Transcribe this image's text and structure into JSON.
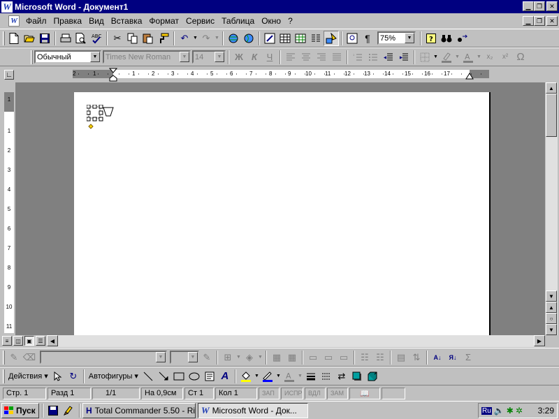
{
  "window": {
    "title": "Microsoft Word - Документ1",
    "app_icon": "W",
    "controls": [
      "minimize-icon",
      "restore-icon",
      "close-icon"
    ]
  },
  "menu": {
    "items": [
      {
        "label": "Файл"
      },
      {
        "label": "Правка"
      },
      {
        "label": "Вид"
      },
      {
        "label": "Вставка"
      },
      {
        "label": "Формат"
      },
      {
        "label": "Сервис"
      },
      {
        "label": "Таблица"
      },
      {
        "label": "Окно"
      },
      {
        "label": "?"
      }
    ]
  },
  "standard_toolbar": {
    "zoom": "75%"
  },
  "formatting_toolbar": {
    "style": "Обычный",
    "font": "Times New Roman",
    "size": "14",
    "bold": "Ж",
    "italic": "К",
    "underline": "Ч",
    "omega": "Ω"
  },
  "ruler": {
    "h_numbers": [
      "2",
      "1",
      "1",
      "2",
      "3",
      "4",
      "5",
      "6",
      "7",
      "8",
      "9",
      "10",
      "11",
      "12",
      "13",
      "14",
      "15",
      "16",
      "17"
    ],
    "v_numbers": [
      "1",
      "1",
      "2",
      "3",
      "4",
      "5",
      "6",
      "7",
      "8",
      "9",
      "10",
      "11"
    ]
  },
  "drawing_toolbar": {
    "actions": "Действия",
    "autoshapes": "Автофигуры"
  },
  "status": {
    "page": "Стр. 1",
    "section": "Разд 1",
    "pages": "1/1",
    "position": "На 0,9см",
    "line": "Ст 1",
    "column": "Кол 1",
    "rec": "ЗАП",
    "trk": "ИСПР",
    "ext": "ВДЛ",
    "ovr": "ЗАМ"
  },
  "taskbar": {
    "start": "Пуск",
    "tasks": [
      {
        "label": "Total Commander 5.50 - Ri...",
        "icon": "total-commander-icon"
      },
      {
        "label": "Microsoft Word - Док...",
        "icon": "word-icon"
      }
    ],
    "language": "Ru",
    "clock": "3:29"
  },
  "colors": {
    "title_bar": "#000080",
    "face": "#c0c0c0",
    "workspace": "#808080",
    "selection_handle": "#ffd700"
  }
}
